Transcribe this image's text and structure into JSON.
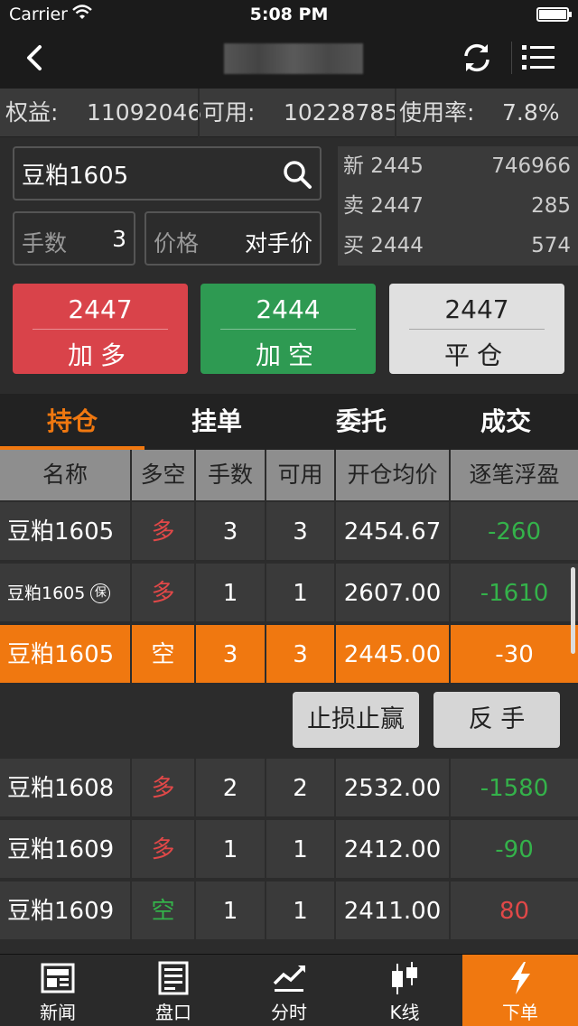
{
  "status": {
    "carrier": "Carrier",
    "time": "5:08 PM"
  },
  "account": {
    "equity_label": "权益:",
    "equity": "11092046",
    "avail_label": "可用:",
    "avail": "10228785",
    "usage_label": "使用率:",
    "usage": "7.8%"
  },
  "order": {
    "symbol": "豆粕1605",
    "qty_label": "手数",
    "qty": "3",
    "price_label": "价格",
    "price": "对手价"
  },
  "quote": [
    {
      "label": "新 2445",
      "value": "746966"
    },
    {
      "label": "卖 2447",
      "value": "285"
    },
    {
      "label": "买 2444",
      "value": "574"
    }
  ],
  "buttons": [
    {
      "price": "2447",
      "label": "加多",
      "color": "#d9434a"
    },
    {
      "price": "2444",
      "label": "加空",
      "color": "#2e9a52"
    },
    {
      "price": "2447",
      "label": "平仓",
      "color": "#e0e0e0"
    }
  ],
  "tabs": [
    "持仓",
    "挂单",
    "委托",
    "成交"
  ],
  "columns": [
    "名称",
    "多空",
    "手数",
    "可用",
    "开仓均价",
    "逐笔浮盈"
  ],
  "rows": [
    {
      "name": "豆粕1605",
      "dir": "多",
      "qty": "3",
      "avail": "3",
      "avg": "2454.67",
      "pnl": "-260"
    },
    {
      "name": "豆粕1605",
      "badge": "保",
      "dir": "多",
      "qty": "1",
      "avail": "1",
      "avg": "2607.00",
      "pnl": "-1610"
    },
    {
      "name": "豆粕1605",
      "dir": "空",
      "qty": "3",
      "avail": "3",
      "avg": "2445.00",
      "pnl": "-30"
    },
    {
      "name": "豆粕1608",
      "dir": "多",
      "qty": "2",
      "avail": "2",
      "avg": "2532.00",
      "pnl": "-1580"
    },
    {
      "name": "豆粕1609",
      "dir": "多",
      "qty": "1",
      "avail": "1",
      "avg": "2412.00",
      "pnl": "-90"
    },
    {
      "name": "豆粕1609",
      "dir": "空",
      "qty": "1",
      "avail": "1",
      "avg": "2411.00",
      "pnl": "80"
    }
  ],
  "row_actions": {
    "stop": "止损止赢",
    "reverse": "反 手"
  },
  "tabbar": [
    "新闻",
    "盘口",
    "分时",
    "K线",
    "下单"
  ],
  "colors": {
    "accent": "#f07810",
    "up": "#e04848",
    "down": "#34b24a"
  }
}
